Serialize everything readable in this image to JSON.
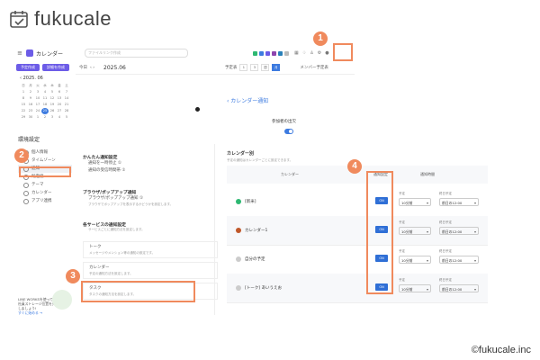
{
  "brand": {
    "name": "fukucale",
    "copyright": "©fukucale.inc"
  },
  "app": {
    "title": "カレンダー",
    "search_placeholder": "ファイルリンク作成",
    "new_event": "予定作成",
    "new_event2": "詳細を作成",
    "prev": "今日",
    "month": "2025.06",
    "views": [
      "1",
      "3",
      "週",
      "月"
    ],
    "member": "メンバー予定表"
  },
  "mini_calendar": {
    "header": "‹ 2025. 06",
    "days": [
      "日",
      "月",
      "火",
      "水",
      "木",
      "金",
      "土"
    ],
    "dates": [
      "1",
      "2",
      "3",
      "4",
      "5",
      "6",
      "7",
      "8",
      "9",
      "10",
      "11",
      "12",
      "13",
      "14",
      "15",
      "16",
      "17",
      "18",
      "19",
      "20",
      "21",
      "22",
      "23",
      "24",
      "25",
      "26",
      "27",
      "28",
      "29",
      "30",
      "1",
      "2",
      "3",
      "4",
      "5"
    ],
    "today_index": 24
  },
  "settings": {
    "title": "環境設定",
    "sidebar": [
      {
        "label": "個人情報",
        "active": false
      },
      {
        "label": "タイムゾーン",
        "active": false
      },
      {
        "label": "通知",
        "active": true
      },
      {
        "label": "既定値",
        "active": false
      },
      {
        "label": "テーマ",
        "active": false
      },
      {
        "label": "カレンダー",
        "active": false
      },
      {
        "label": "アプリ連携",
        "active": false
      }
    ],
    "promo": {
      "line1": "LINE WORKSを使って",
      "line2": "社員ストレージ位置を共有",
      "line3": "しましょう!",
      "link": "すぐに始める →"
    }
  },
  "notif": {
    "simple": "かんたん通知設定",
    "simple_rows": [
      "通知を一時停止 ①",
      "通知の受信時間帯 ①"
    ],
    "browser": "ブラウザ/ポップアップ通知",
    "browser_row": "ブラウザ/ポップアップ通知 ①",
    "browser_desc": "ブラウザでポップアップを表示するかどうかを設定します。",
    "services": "各サービスの通知設定",
    "services_desc": "サービスごとに通知方法を設定します。",
    "service_items": [
      {
        "name": "トーク",
        "desc": "メッセージやメンション等の通知の設定です。"
      },
      {
        "name": "カレンダー",
        "desc": "予定の通知方法を設定します。"
      },
      {
        "name": "タスク",
        "desc": "タスクの通知方法を設定します。"
      }
    ]
  },
  "cal_notif": {
    "back": "‹ カレンダー通知",
    "attend_label": "参加者の出欠",
    "by_calendar": "カレンダー別",
    "by_calendar_desc": "予定の通知はカレンダーごとに設定できます。",
    "col_calendar": "カレンダー",
    "col_setting": "通知設定",
    "col_timing": "通知時間",
    "rows": [
      {
        "name": "[新米]",
        "color": "#2eb872",
        "on": "ON",
        "label1": "予定",
        "label2": "終日予定",
        "value1": "10分前",
        "value2": "前日の12:00"
      },
      {
        "name": "カレンダー1",
        "color": "#c0582a",
        "on": "ON",
        "label1": "予定",
        "label2": "終日予定",
        "value1": "10分前",
        "value2": "前日の12:00"
      },
      {
        "name": "自分の予定",
        "color": "#cccccc",
        "on": "ON",
        "label1": "予定",
        "label2": "終日予定",
        "value1": "10分前",
        "value2": "前日の12:00"
      },
      {
        "name": "[トーク] あいうえお",
        "color": "#cccccc",
        "on": "ON",
        "label1": "予定",
        "label2": "終日予定",
        "value1": "10分前",
        "value2": "前日の12:00"
      }
    ]
  },
  "badges": [
    "1",
    "2",
    "3",
    "4"
  ],
  "colors": {
    "accent": "#f08a5d",
    "primary": "#3d7be0",
    "purple": "#6c5ce7"
  }
}
